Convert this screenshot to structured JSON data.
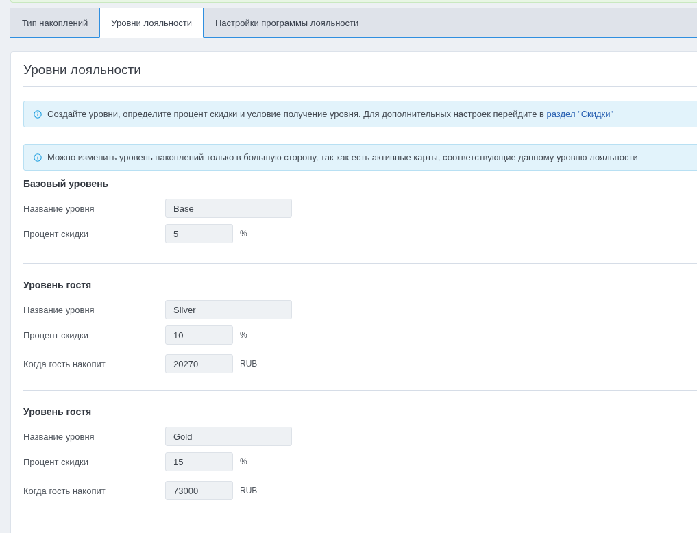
{
  "tabs": [
    {
      "label": "Тип накоплений",
      "selected": false
    },
    {
      "label": "Уровни лояльности",
      "selected": true
    },
    {
      "label": "Настройки программы лояльности",
      "selected": false
    }
  ],
  "panel": {
    "title": "Уровни лояльности",
    "alerts": [
      {
        "text": "Создайте уровни, определите процент скидки и условие получение уровня. Для дополнительных настроек перейдите в",
        "link": "раздел \"Скидки\""
      },
      {
        "text": "Можно изменить уровень накоплений только в большую сторону, так как есть активные карты, соответствующие данному уровню лояльности"
      }
    ],
    "levels": [
      {
        "heading": "Базовый уровень",
        "fields": [
          {
            "kind": "text",
            "label": "Название уровня",
            "value": "Base",
            "disabled": true
          },
          {
            "kind": "number",
            "label": "Процент скидки",
            "value": "5",
            "unit": "%",
            "disabled": true
          }
        ]
      },
      {
        "heading": "Уровень гостя",
        "fields": [
          {
            "kind": "text",
            "label": "Название уровня",
            "value": "Silver",
            "disabled": true
          },
          {
            "kind": "number",
            "label": "Процент скидки",
            "value": "10",
            "unit": "%",
            "disabled": true
          },
          {
            "kind": "amount",
            "label": "Когда гость накопит",
            "value": "20270",
            "unit": "RUB",
            "disabled": true
          }
        ]
      },
      {
        "heading": "Уровень гостя",
        "fields": [
          {
            "kind": "text",
            "label": "Название уровня",
            "value": "Gold",
            "disabled": true
          },
          {
            "kind": "number",
            "label": "Процент скидки",
            "value": "15",
            "unit": "%",
            "disabled": true
          },
          {
            "kind": "amount",
            "label": "Когда гость накопит",
            "value": "73000",
            "unit": "RUB",
            "disabled": true
          }
        ]
      }
    ]
  }
}
